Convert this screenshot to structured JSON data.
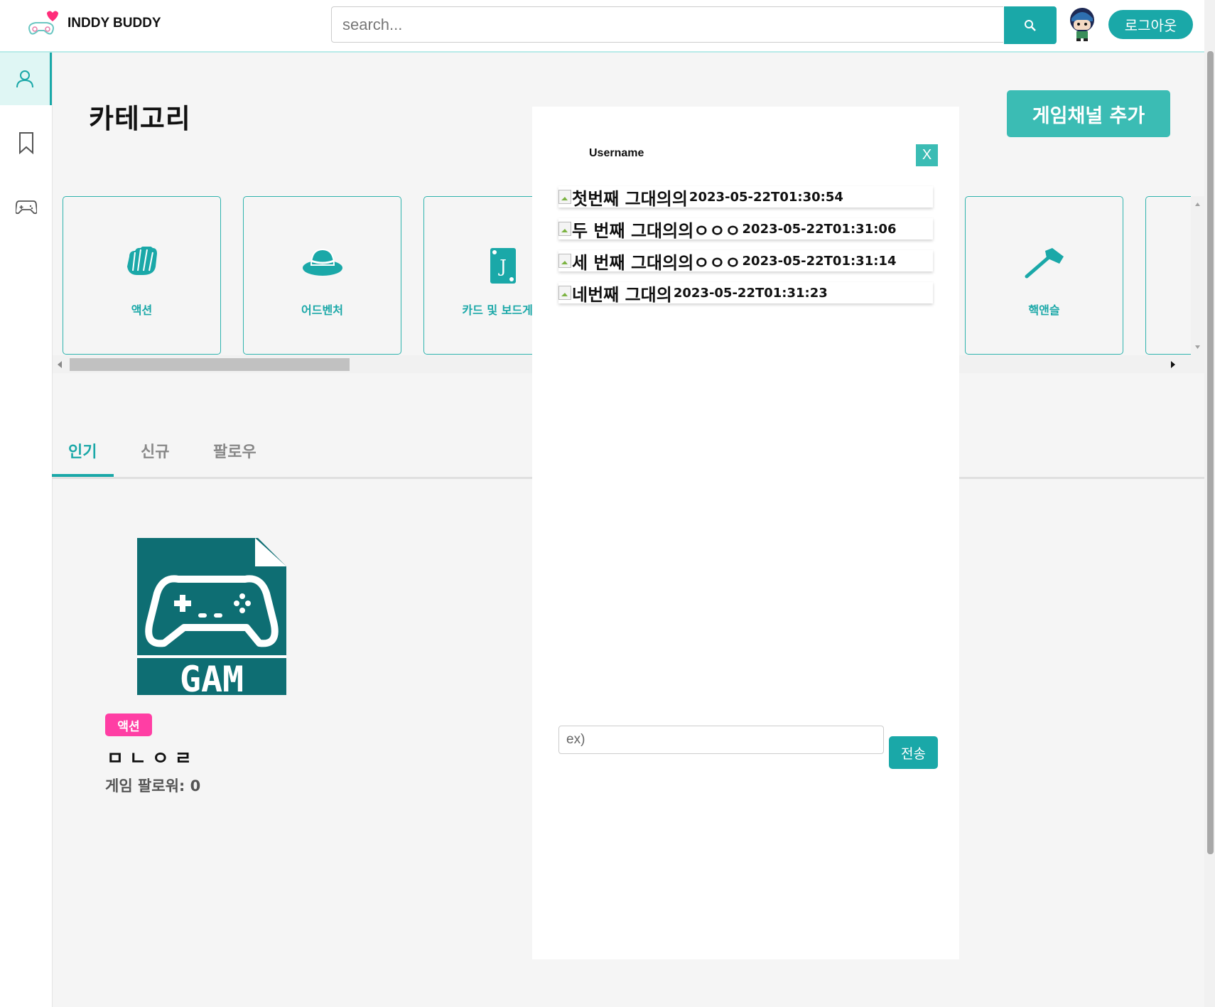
{
  "header": {
    "brand": "INDDY BUDDY",
    "search_placeholder": "search...",
    "logout_label": "로그아웃"
  },
  "sidebar": {
    "items": [
      {
        "icon": "user-icon",
        "active": true
      },
      {
        "icon": "bookmark-icon",
        "active": false
      },
      {
        "icon": "gamepad-icon",
        "active": false
      }
    ]
  },
  "category": {
    "title": "카테고리",
    "add_button": "게임채널 추가",
    "cards": [
      {
        "label": "액션",
        "icon": "fist-icon"
      },
      {
        "label": "어드벤처",
        "icon": "hat-icon"
      },
      {
        "label": "카드 및 보드게임",
        "icon": "playing-card-icon"
      },
      {
        "label": "핵앤슬",
        "icon": "hammer-icon"
      }
    ]
  },
  "tabs": {
    "popular": "인기",
    "new": "신규",
    "follow": "팔로우"
  },
  "game": {
    "genre": "액션",
    "title": "ㅁㄴㅇㄹ",
    "followers": "게임 팔로워: 0",
    "thumb_text": "GAM"
  },
  "chat": {
    "username": "Username",
    "close_label": "X",
    "messages": [
      {
        "text": "첫번째 그대의의",
        "time": "2023-05-22T01:30:54"
      },
      {
        "text": "두 번째 그대의의ㅇㅇㅇ",
        "time": "2023-05-22T01:31:06"
      },
      {
        "text": "세 번째 그대의의ㅇㅇㅇ",
        "time": "2023-05-22T01:31:14"
      },
      {
        "text": "네번째 그대의",
        "time": "2023-05-22T01:31:23"
      }
    ],
    "input_placeholder": "ex)",
    "send_label": "전송"
  },
  "colors": {
    "accent": "#1aa8a8",
    "badge": "#ff3ea4",
    "thumb": "#0e6e73"
  }
}
